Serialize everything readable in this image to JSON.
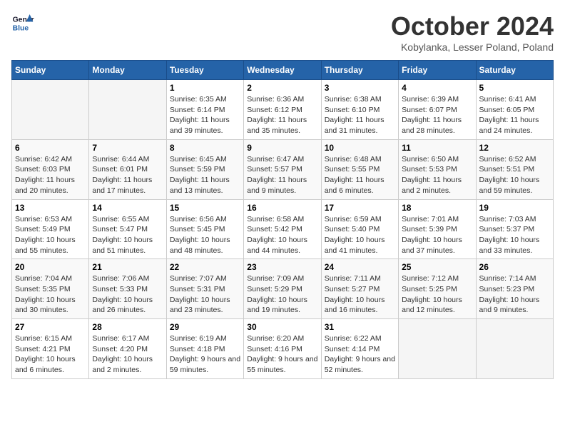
{
  "logo": {
    "line1": "General",
    "line2": "Blue"
  },
  "title": "October 2024",
  "subtitle": "Kobylanka, Lesser Poland, Poland",
  "days_header": [
    "Sunday",
    "Monday",
    "Tuesday",
    "Wednesday",
    "Thursday",
    "Friday",
    "Saturday"
  ],
  "weeks": [
    [
      {
        "day": "",
        "info": ""
      },
      {
        "day": "",
        "info": ""
      },
      {
        "day": "1",
        "info": "Sunrise: 6:35 AM\nSunset: 6:14 PM\nDaylight: 11 hours and 39 minutes."
      },
      {
        "day": "2",
        "info": "Sunrise: 6:36 AM\nSunset: 6:12 PM\nDaylight: 11 hours and 35 minutes."
      },
      {
        "day": "3",
        "info": "Sunrise: 6:38 AM\nSunset: 6:10 PM\nDaylight: 11 hours and 31 minutes."
      },
      {
        "day": "4",
        "info": "Sunrise: 6:39 AM\nSunset: 6:07 PM\nDaylight: 11 hours and 28 minutes."
      },
      {
        "day": "5",
        "info": "Sunrise: 6:41 AM\nSunset: 6:05 PM\nDaylight: 11 hours and 24 minutes."
      }
    ],
    [
      {
        "day": "6",
        "info": "Sunrise: 6:42 AM\nSunset: 6:03 PM\nDaylight: 11 hours and 20 minutes."
      },
      {
        "day": "7",
        "info": "Sunrise: 6:44 AM\nSunset: 6:01 PM\nDaylight: 11 hours and 17 minutes."
      },
      {
        "day": "8",
        "info": "Sunrise: 6:45 AM\nSunset: 5:59 PM\nDaylight: 11 hours and 13 minutes."
      },
      {
        "day": "9",
        "info": "Sunrise: 6:47 AM\nSunset: 5:57 PM\nDaylight: 11 hours and 9 minutes."
      },
      {
        "day": "10",
        "info": "Sunrise: 6:48 AM\nSunset: 5:55 PM\nDaylight: 11 hours and 6 minutes."
      },
      {
        "day": "11",
        "info": "Sunrise: 6:50 AM\nSunset: 5:53 PM\nDaylight: 11 hours and 2 minutes."
      },
      {
        "day": "12",
        "info": "Sunrise: 6:52 AM\nSunset: 5:51 PM\nDaylight: 10 hours and 59 minutes."
      }
    ],
    [
      {
        "day": "13",
        "info": "Sunrise: 6:53 AM\nSunset: 5:49 PM\nDaylight: 10 hours and 55 minutes."
      },
      {
        "day": "14",
        "info": "Sunrise: 6:55 AM\nSunset: 5:47 PM\nDaylight: 10 hours and 51 minutes."
      },
      {
        "day": "15",
        "info": "Sunrise: 6:56 AM\nSunset: 5:45 PM\nDaylight: 10 hours and 48 minutes."
      },
      {
        "day": "16",
        "info": "Sunrise: 6:58 AM\nSunset: 5:42 PM\nDaylight: 10 hours and 44 minutes."
      },
      {
        "day": "17",
        "info": "Sunrise: 6:59 AM\nSunset: 5:40 PM\nDaylight: 10 hours and 41 minutes."
      },
      {
        "day": "18",
        "info": "Sunrise: 7:01 AM\nSunset: 5:39 PM\nDaylight: 10 hours and 37 minutes."
      },
      {
        "day": "19",
        "info": "Sunrise: 7:03 AM\nSunset: 5:37 PM\nDaylight: 10 hours and 33 minutes."
      }
    ],
    [
      {
        "day": "20",
        "info": "Sunrise: 7:04 AM\nSunset: 5:35 PM\nDaylight: 10 hours and 30 minutes."
      },
      {
        "day": "21",
        "info": "Sunrise: 7:06 AM\nSunset: 5:33 PM\nDaylight: 10 hours and 26 minutes."
      },
      {
        "day": "22",
        "info": "Sunrise: 7:07 AM\nSunset: 5:31 PM\nDaylight: 10 hours and 23 minutes."
      },
      {
        "day": "23",
        "info": "Sunrise: 7:09 AM\nSunset: 5:29 PM\nDaylight: 10 hours and 19 minutes."
      },
      {
        "day": "24",
        "info": "Sunrise: 7:11 AM\nSunset: 5:27 PM\nDaylight: 10 hours and 16 minutes."
      },
      {
        "day": "25",
        "info": "Sunrise: 7:12 AM\nSunset: 5:25 PM\nDaylight: 10 hours and 12 minutes."
      },
      {
        "day": "26",
        "info": "Sunrise: 7:14 AM\nSunset: 5:23 PM\nDaylight: 10 hours and 9 minutes."
      }
    ],
    [
      {
        "day": "27",
        "info": "Sunrise: 6:15 AM\nSunset: 4:21 PM\nDaylight: 10 hours and 6 minutes."
      },
      {
        "day": "28",
        "info": "Sunrise: 6:17 AM\nSunset: 4:20 PM\nDaylight: 10 hours and 2 minutes."
      },
      {
        "day": "29",
        "info": "Sunrise: 6:19 AM\nSunset: 4:18 PM\nDaylight: 9 hours and 59 minutes."
      },
      {
        "day": "30",
        "info": "Sunrise: 6:20 AM\nSunset: 4:16 PM\nDaylight: 9 hours and 55 minutes."
      },
      {
        "day": "31",
        "info": "Sunrise: 6:22 AM\nSunset: 4:14 PM\nDaylight: 9 hours and 52 minutes."
      },
      {
        "day": "",
        "info": ""
      },
      {
        "day": "",
        "info": ""
      }
    ]
  ]
}
